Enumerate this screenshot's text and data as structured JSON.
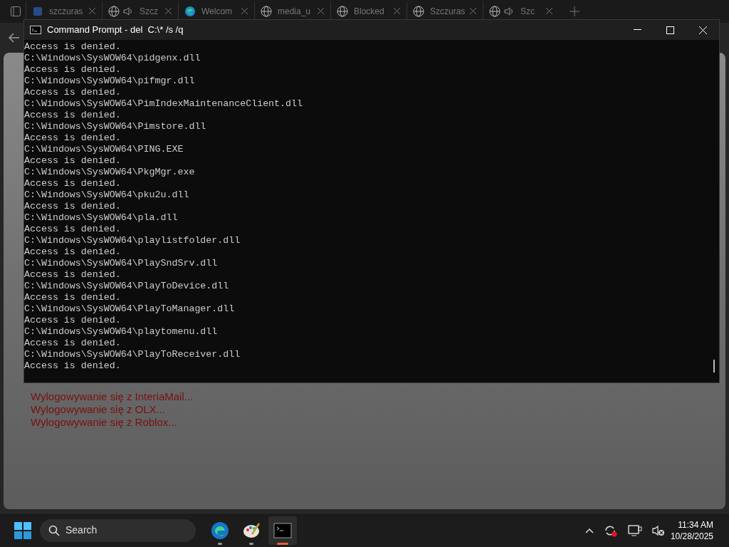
{
  "browser": {
    "tabs": [
      {
        "label": "szczuras",
        "kind": "favicon",
        "audio": false
      },
      {
        "label": "Szcz",
        "kind": "globe",
        "audio": true
      },
      {
        "label": "Welcom",
        "kind": "edge",
        "audio": false
      },
      {
        "label": "media_u",
        "kind": "globe",
        "audio": false
      },
      {
        "label": "Blocked",
        "kind": "globe",
        "audio": false
      },
      {
        "label": "Szczuras",
        "kind": "globe",
        "audio": false
      },
      {
        "label": "Szc",
        "kind": "globe",
        "audio": true
      }
    ],
    "page": {
      "messages": [
        "Wylogowywanie się z InteriaMail...",
        "Wylogowywanie się z OLX...",
        "Wylogowywanie się z Roblox..."
      ]
    }
  },
  "console": {
    "title": "Command Prompt - del  C:\\* /s /q",
    "lines": [
      "Access is denied.",
      "C:\\Windows\\SysWOW64\\pidgenx.dll",
      "Access is denied.",
      "C:\\Windows\\SysWOW64\\pifmgr.dll",
      "Access is denied.",
      "C:\\Windows\\SysWOW64\\PimIndexMaintenanceClient.dll",
      "Access is denied.",
      "C:\\Windows\\SysWOW64\\Pimstore.dll",
      "Access is denied.",
      "C:\\Windows\\SysWOW64\\PING.EXE",
      "Access is denied.",
      "C:\\Windows\\SysWOW64\\PkgMgr.exe",
      "Access is denied.",
      "C:\\Windows\\SysWOW64\\pku2u.dll",
      "Access is denied.",
      "C:\\Windows\\SysWOW64\\pla.dll",
      "Access is denied.",
      "C:\\Windows\\SysWOW64\\playlistfolder.dll",
      "Access is denied.",
      "C:\\Windows\\SysWOW64\\PlaySndSrv.dll",
      "Access is denied.",
      "C:\\Windows\\SysWOW64\\PlayToDevice.dll",
      "Access is denied.",
      "C:\\Windows\\SysWOW64\\PlayToManager.dll",
      "Access is denied.",
      "C:\\Windows\\SysWOW64\\playtomenu.dll",
      "Access is denied.",
      "C:\\Windows\\SysWOW64\\PlayToReceiver.dll",
      "Access is denied."
    ]
  },
  "taskbar": {
    "search": {
      "placeholder": "Search"
    },
    "apps": [
      {
        "kind": "edge",
        "active": false
      },
      {
        "kind": "paint",
        "active": false
      },
      {
        "kind": "terminal",
        "active": true
      }
    ],
    "time": "11:34 AM",
    "date": "10/28/2025"
  }
}
